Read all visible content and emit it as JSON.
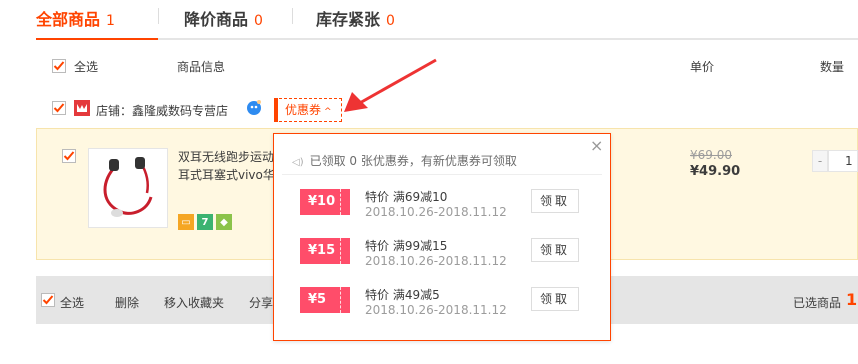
{
  "tabs": [
    {
      "label": "全部商品",
      "count": "1"
    },
    {
      "label": "降价商品",
      "count": "0"
    },
    {
      "label": "库存紧张",
      "count": "0"
    }
  ],
  "header": {
    "select_all": "全选",
    "product_info": "商品信息",
    "unit_price": "单价",
    "quantity": "数量"
  },
  "shop": {
    "label": "店铺：鑫隆威数码专营店",
    "coupon_button": "优惠券",
    "coupon_caret": "^"
  },
  "item": {
    "title_line1": "双耳无线跑步运动",
    "title_line2": "耳式耳塞式vivo华为",
    "old_price": "¥69.00",
    "price": "¥49.90",
    "qty_minus": "-",
    "qty": "1",
    "badge_mid": "7"
  },
  "footer": {
    "select_all": "全选",
    "delete": "删除",
    "move_fav": "移入收藏夹",
    "share": "分享",
    "selected_label": "已选商品",
    "selected_count": "1"
  },
  "coupon_popup": {
    "close": "×",
    "head": "已领取 0 张优惠券，有新优惠券可领取",
    "coupons": [
      {
        "amount": "¥10",
        "name": "特价 满69减10",
        "date": "2018.10.26-2018.11.12",
        "button": "领取"
      },
      {
        "amount": "¥15",
        "name": "特价 满99减15",
        "date": "2018.10.26-2018.11.12",
        "button": "领取"
      },
      {
        "amount": "¥5",
        "name": "特价 满49减5",
        "date": "2018.10.26-2018.11.12",
        "button": "领取"
      }
    ]
  },
  "colors": {
    "accent": "#ff4400",
    "coupon_pink": "#ff4d6a",
    "item_bg": "#fff8e1",
    "footer_bg": "#e5e5e5"
  },
  "icons": [
    "checkbox-checked-icon",
    "shop-logo-icon",
    "wangwang-chat-icon",
    "arrow-annotation-icon",
    "speaker-icon",
    "close-icon",
    "earphone-product-image"
  ]
}
